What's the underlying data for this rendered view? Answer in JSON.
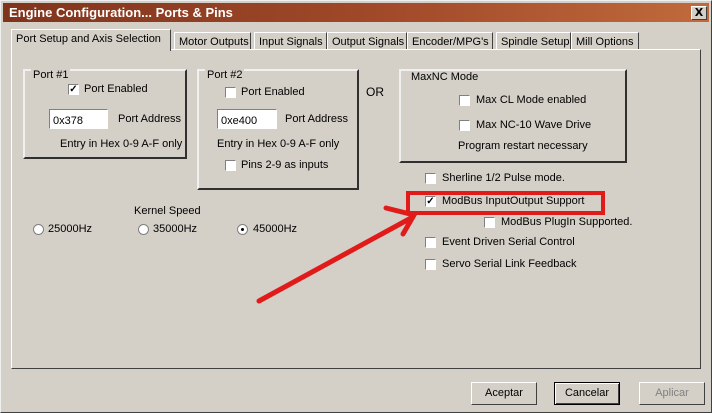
{
  "window": {
    "title": "Engine Configuration... Ports & Pins",
    "close_glyph": "X"
  },
  "tabs": [
    {
      "label": "Port Setup and Axis Selection",
      "active": true
    },
    {
      "label": "Motor Outputs"
    },
    {
      "label": "Input Signals"
    },
    {
      "label": "Output Signals"
    },
    {
      "label": "Encoder/MPG's"
    },
    {
      "label": "Spindle Setup"
    },
    {
      "label": "Mill Options"
    }
  ],
  "port1": {
    "title": "Port #1",
    "enabled_label": "Port Enabled",
    "enabled": true,
    "address_value": "0x378",
    "address_label": "Port Address",
    "hint": "Entry in Hex 0-9 A-F only"
  },
  "port2": {
    "title": "Port #2",
    "enabled_label": "Port Enabled",
    "enabled": false,
    "address_value": "0xe400",
    "address_label": "Port Address",
    "hint": "Entry in Hex 0-9 A-F only",
    "pins_label": "Pins 2-9 as inputs",
    "pins_checked": false
  },
  "or_label": "OR",
  "maxnc": {
    "title": "MaxNC Mode",
    "cl_label": "Max CL Mode enabled",
    "cl_checked": false,
    "wave_label": "Max NC-10 Wave Drive",
    "wave_checked": false,
    "restart_note": "Program restart necessary"
  },
  "options": {
    "sherline_label": "Sherline 1/2 Pulse mode.",
    "sherline_checked": false,
    "modbus_io_label": "ModBus InputOutput Support",
    "modbus_io_checked": true,
    "modbus_plugin_label": "ModBus PlugIn Supported.",
    "modbus_plugin_checked": false,
    "event_serial_label": "Event Driven Serial Control",
    "event_serial_checked": false,
    "servo_serial_label": "Servo Serial Link Feedback",
    "servo_serial_checked": false
  },
  "kernel": {
    "title": "Kernel Speed",
    "options": [
      {
        "label": "25000Hz",
        "selected": false
      },
      {
        "label": "35000Hz",
        "selected": false
      },
      {
        "label": "45000Hz",
        "selected": true
      }
    ]
  },
  "buttons": {
    "accept": "Aceptar",
    "cancel": "Cancelar",
    "apply": "Aplicar"
  },
  "annotation_color": "#e11a1a"
}
